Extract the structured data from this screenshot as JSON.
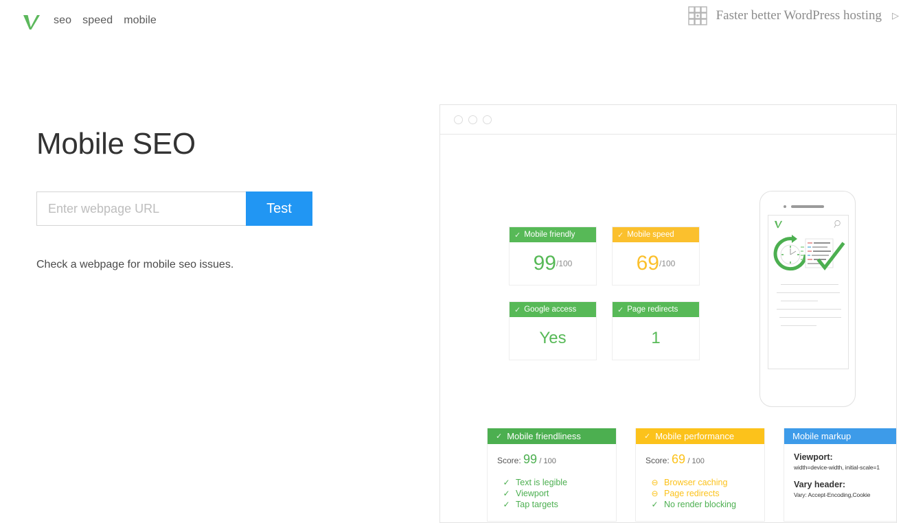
{
  "header": {
    "logo_icon": "green-check-logo",
    "nav": [
      {
        "label": "seo"
      },
      {
        "label": "speed"
      },
      {
        "label": "mobile"
      }
    ],
    "promo": {
      "icon": "grid-squares-icon",
      "text": "Faster better WordPress hosting",
      "caret": "▷"
    }
  },
  "main": {
    "title": "Mobile SEO",
    "url_input": {
      "value": "",
      "placeholder": "Enter webpage URL"
    },
    "test_button": "Test",
    "description": "Check a webpage for mobile seo issues."
  },
  "preview": {
    "browser_dots": 3,
    "score_cards": [
      {
        "title": "Mobile friendly",
        "icon": "check-icon",
        "head_color": "#57b957",
        "value": "99",
        "denominator": "/100",
        "value_color": "#57b957",
        "type": "score"
      },
      {
        "title": "Mobile speed",
        "icon": "check-icon",
        "head_color": "#fbc02d",
        "value": "69",
        "denominator": "/100",
        "value_color": "#fbc02d",
        "type": "score"
      },
      {
        "title": "Google access",
        "icon": "check-icon",
        "head_color": "#57b957",
        "value": "Yes",
        "denominator": "",
        "value_color": "#57b957",
        "type": "word"
      },
      {
        "title": "Page redirects",
        "icon": "check-icon",
        "head_color": "#57b957",
        "value": "1",
        "denominator": "",
        "value_color": "#57b957",
        "type": "word"
      }
    ],
    "phone": {
      "logo_icon": "green-check-logo",
      "search_icon": "magnifier-icon",
      "hero_icon": "clock-document-check-illustration"
    },
    "detail_cards": [
      {
        "title": "Mobile friendliness",
        "icon": "check-icon",
        "head_color": "#4caf50",
        "score_label": "Score:",
        "score_value": "99",
        "score_den": "/ 100",
        "score_color": "green",
        "items": [
          {
            "label": "Text is legible",
            "state": "ok",
            "glyph": "✓"
          },
          {
            "label": "Viewport",
            "state": "ok",
            "glyph": "✓"
          },
          {
            "label": "Tap targets",
            "state": "ok",
            "glyph": "✓"
          }
        ]
      },
      {
        "title": "Mobile performance",
        "icon": "check-icon",
        "head_color": "#fcc21b",
        "score_label": "Score:",
        "score_value": "69",
        "score_den": "/ 100",
        "score_color": "amber",
        "items": [
          {
            "label": "Browser caching",
            "state": "warn",
            "glyph": "⊖"
          },
          {
            "label": "Page redirects",
            "state": "warn",
            "glyph": "⊖"
          },
          {
            "label": "No render blocking",
            "state": "ok",
            "glyph": "✓"
          }
        ]
      },
      {
        "title": "Mobile markup",
        "head_color": "#3d9be9",
        "fields": [
          {
            "label": "Viewport:",
            "value": "width=device-width, initial-scale=1"
          },
          {
            "label": "Vary header:",
            "value": "Vary: Accept-Encoding,Cookie"
          }
        ]
      }
    ]
  },
  "colors": {
    "accent_blue": "#2196f3",
    "green": "#4caf50",
    "amber": "#fcc21b",
    "panel_blue": "#3d9be9"
  }
}
